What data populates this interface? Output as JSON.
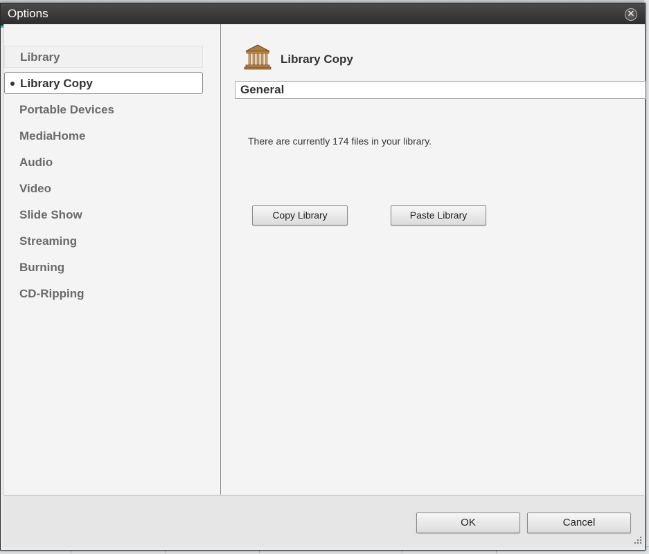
{
  "window": {
    "title": "Options"
  },
  "sidebar": {
    "items": [
      {
        "label": "Library"
      },
      {
        "label": "Library Copy"
      },
      {
        "label": "Portable Devices"
      },
      {
        "label": "MediaHome"
      },
      {
        "label": "Audio"
      },
      {
        "label": "Video"
      },
      {
        "label": "Slide Show"
      },
      {
        "label": "Streaming"
      },
      {
        "label": "Burning"
      },
      {
        "label": "CD-Ripping"
      }
    ],
    "selected": "Library Copy"
  },
  "panel": {
    "icon": "library-temple-icon",
    "title": "Library Copy",
    "section": "General",
    "info": "There are currently 174 files in your library.",
    "copy_button": "Copy Library",
    "paste_button": "Paste Library"
  },
  "footer": {
    "ok": "OK",
    "cancel": "Cancel"
  },
  "colors": {
    "accent": "#27b6c4",
    "titlebar": "#333333"
  }
}
